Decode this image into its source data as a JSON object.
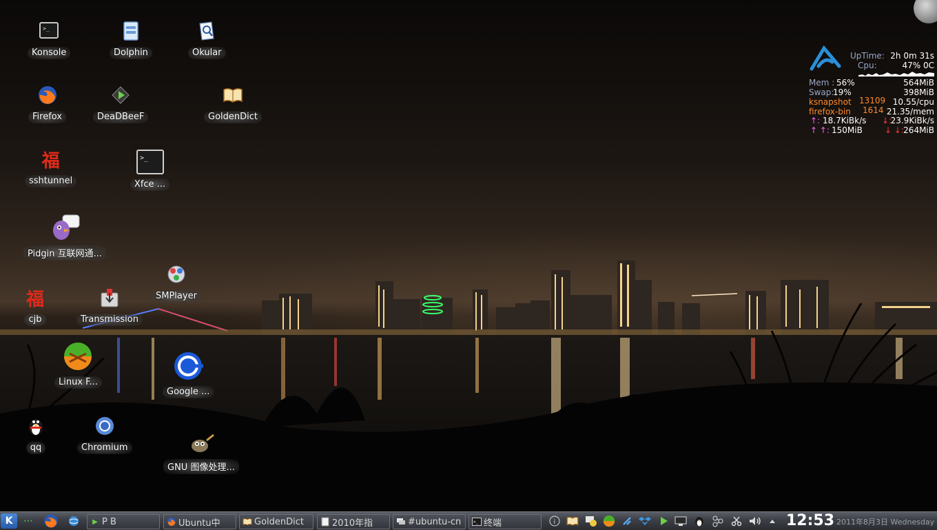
{
  "desktop": {
    "icons": [
      {
        "name": "konsole",
        "label": "Konsole",
        "icon": "terminal-icon"
      },
      {
        "name": "dolphin",
        "label": "Dolphin",
        "icon": "file-manager-icon"
      },
      {
        "name": "okular",
        "label": "Okular",
        "icon": "document-viewer-icon"
      },
      {
        "name": "firefox",
        "label": "Firefox",
        "icon": "firefox-icon"
      },
      {
        "name": "deadbeef",
        "label": "DeaDBeeF",
        "icon": "media-play-icon"
      },
      {
        "name": "goldendict",
        "label": "GoldenDict",
        "icon": "dictionary-book-icon"
      },
      {
        "name": "sshtunnel",
        "label": "sshtunnel",
        "icon": "fu-character-icon"
      },
      {
        "name": "xfce",
        "label": "Xfce ...",
        "icon": "terminal-icon"
      },
      {
        "name": "pidgin",
        "label": "Pidgin 互联网通...",
        "icon": "pidgin-icon"
      },
      {
        "name": "smplayer",
        "label": "SMPlayer",
        "icon": "smplayer-icon"
      },
      {
        "name": "cjb",
        "label": "cjb",
        "icon": "fu-character-icon"
      },
      {
        "name": "transmission",
        "label": "Transmission",
        "icon": "transmission-icon"
      },
      {
        "name": "linux-f",
        "label": "Linux F...",
        "icon": "linux-fetion-icon"
      },
      {
        "name": "google-earth",
        "label": "Google ...",
        "icon": "google-earth-icon"
      },
      {
        "name": "qq",
        "label": "qq",
        "icon": "penguin-icon"
      },
      {
        "name": "chromium",
        "label": "Chromium",
        "icon": "chromium-icon"
      },
      {
        "name": "gimp",
        "label": "GNU 图像处理...",
        "icon": "gimp-icon"
      }
    ]
  },
  "conky": {
    "uptime_label": "UpTime:",
    "uptime": "2h 0m 31s",
    "cpu_label": "Cpu:",
    "cpu": "47% 0C",
    "mem_label": "Mem :",
    "mem_pct": "56%",
    "mem_used": "564MiB",
    "swap_label": "Swap:",
    "swap_pct": "19%",
    "swap_used": "398MiB",
    "top_cpu_name": "ksnapshot",
    "top_cpu_pid": "13109",
    "top_cpu_val": "10.55/cpu",
    "top_mem_name": "firefox-bin",
    "top_mem_pid": "1614",
    "top_mem_val": "21.35/mem",
    "up_arrow": "↑:",
    "up_speed": "18.7KiBk/s",
    "down_arrow": "↓:",
    "down_speed": "23.9KiBk/s",
    "up_total_arrow": "↑ ↑:",
    "up_total": "150MiB",
    "down_total_arrow": "↓ ↓:",
    "down_total": "264MiB"
  },
  "taskbar": {
    "pager": "P B",
    "tasks": [
      {
        "name": "firefox",
        "label": "Ubuntu中",
        "icon": "firefox-icon"
      },
      {
        "name": "goldendict",
        "label": "GoldenDict",
        "icon": "dictionary-book-icon"
      },
      {
        "name": "document",
        "label": "2010年指",
        "icon": "document-icon"
      },
      {
        "name": "irc",
        "label": "#ubuntu-cn",
        "icon": "chat-icon"
      },
      {
        "name": "terminal",
        "label": "终端",
        "icon": "terminal-icon"
      }
    ],
    "clock": "12:53",
    "date": "2011年8月3日 Wednesday"
  },
  "colors": {
    "accent_blue": "#2a8fd8",
    "conky_grey": "#9aa8c8",
    "conky_orange": "#ff8a2a",
    "conky_pink": "#ff66ff",
    "conky_red": "#ff3b3b"
  }
}
